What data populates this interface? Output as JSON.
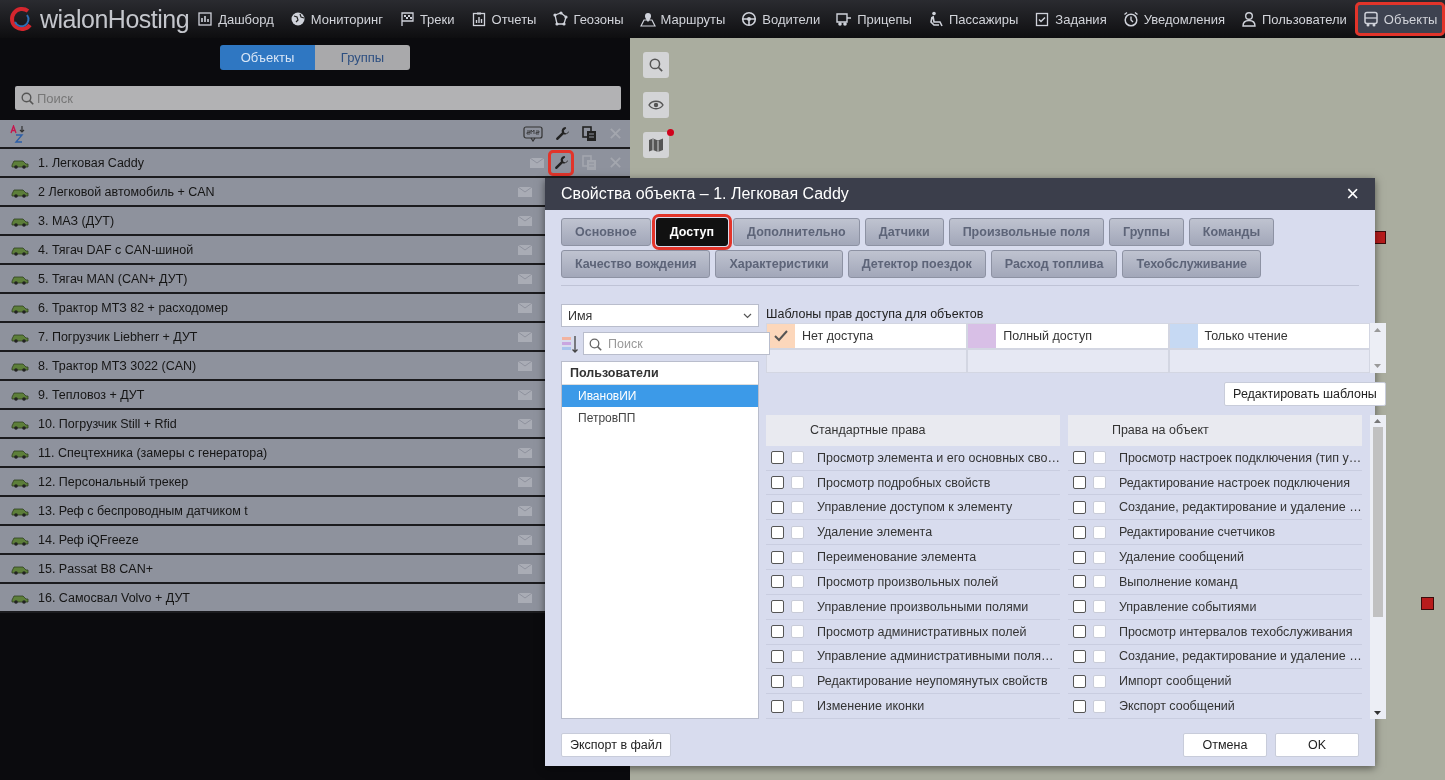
{
  "top_bar": {
    "logo": "wialonHosting",
    "nav": [
      {
        "label": "Дашборд",
        "selected": false,
        "highlighted": false
      },
      {
        "label": "Мониторинг",
        "selected": false,
        "highlighted": false
      },
      {
        "label": "Треки",
        "selected": false,
        "highlighted": false
      },
      {
        "label": "Отчеты",
        "selected": false,
        "highlighted": false
      },
      {
        "label": "Геозоны",
        "selected": false,
        "highlighted": false
      },
      {
        "label": "Маршруты",
        "selected": false,
        "highlighted": false
      },
      {
        "label": "Водители",
        "selected": false,
        "highlighted": false
      },
      {
        "label": "Прицепы",
        "selected": false,
        "highlighted": false
      },
      {
        "label": "Пассажиры",
        "selected": false,
        "highlighted": false
      },
      {
        "label": "Задания",
        "selected": false,
        "highlighted": false
      },
      {
        "label": "Уведомления",
        "selected": false,
        "highlighted": false
      },
      {
        "label": "Пользователи",
        "selected": false,
        "highlighted": false
      },
      {
        "label": "Объекты",
        "selected": true,
        "highlighted": true
      }
    ]
  },
  "left_panel": {
    "tabs": [
      {
        "label": "Объекты",
        "selected": true
      },
      {
        "label": "Группы",
        "selected": false
      }
    ],
    "search": {
      "placeholder": "Поиск"
    },
    "units": [
      {
        "name": "1. Легковая Caddy",
        "tools": {
          "highlighted": true
        }
      },
      {
        "name": "2 Легковой автомобиль + CAN"
      },
      {
        "name": "3. МАЗ (ДУТ)"
      },
      {
        "name": "4. Тягач DAF с CAN-шиной"
      },
      {
        "name": "5. Тягач MAN (CAN+ ДУТ)"
      },
      {
        "name": "6. Трактор МТЗ 82 + расходомер"
      },
      {
        "name": "7. Погрузчик Liebherr + ДУТ"
      },
      {
        "name": "8. Трактор МТЗ 3022 (CAN)"
      },
      {
        "name": "9. Тепловоз + ДУТ"
      },
      {
        "name": "10. Погрузчик Still + Rfid"
      },
      {
        "name": "11. Спецтехника (замеры с генератора)"
      },
      {
        "name": "12. Персональный трекер"
      },
      {
        "name": "13. Реф с беспроводным датчиком t"
      },
      {
        "name": "14. Реф iQFreeze"
      },
      {
        "name": "15. Passat B8 CAN+"
      },
      {
        "name": "16. Самосвал Volvo + ДУТ"
      }
    ]
  },
  "dialog": {
    "title": "Свойства объекта – 1. Легковая Caddy",
    "close": "×",
    "tab_rows": [
      [
        {
          "label": "Основное",
          "selected": false,
          "highlighted": false
        },
        {
          "label": "Доступ",
          "selected": true,
          "highlighted": true
        },
        {
          "label": "Дополнительно",
          "selected": false,
          "highlighted": false
        },
        {
          "label": "Датчики",
          "selected": false,
          "highlighted": false
        },
        {
          "label": "Произвольные поля",
          "selected": false,
          "highlighted": false
        },
        {
          "label": "Группы",
          "selected": false,
          "highlighted": false
        },
        {
          "label": "Команды",
          "selected": false,
          "highlighted": false
        }
      ],
      [
        {
          "label": "Качество вождения",
          "selected": false,
          "highlighted": false
        },
        {
          "label": "Характеристики",
          "selected": false,
          "highlighted": false
        },
        {
          "label": "Детектор поездок",
          "selected": false,
          "highlighted": false
        },
        {
          "label": "Расход топлива",
          "selected": false,
          "highlighted": false
        },
        {
          "label": "Техобслуживание",
          "selected": false,
          "highlighted": false
        }
      ]
    ],
    "filter_select": "Имя",
    "user_search": {
      "placeholder": "Поиск"
    },
    "users": {
      "header": "Пользователи",
      "items": [
        {
          "name": "ИвановИИ",
          "selected": true
        },
        {
          "name": "ПетровПП",
          "selected": false
        }
      ]
    },
    "templates": {
      "title": "Шаблоны прав доступа для объектов",
      "items": [
        {
          "label": "Нет доступа",
          "color": "#fcd7bb",
          "selected": true
        },
        {
          "label": "Полный доступ",
          "color": "#d8bfe6",
          "selected": false
        },
        {
          "label": "Только чтение",
          "color": "#c6d9f3",
          "selected": false
        }
      ]
    },
    "edit_templates": "Редактировать шаблоны",
    "rights_columns": [
      {
        "header": "Стандартные права",
        "rights": [
          {
            "label": "Просмотр элемента и его основных сво…",
            "checked": false,
            "grant_checked": false,
            "grant_disabled": true
          },
          {
            "label": "Просмотр подробных свойств",
            "checked": false,
            "grant_checked": false,
            "grant_disabled": true
          },
          {
            "label": "Управление доступом к элементу",
            "checked": false,
            "grant_checked": false,
            "grant_disabled": true
          },
          {
            "label": "Удаление элемента",
            "checked": false,
            "grant_checked": false,
            "grant_disabled": true
          },
          {
            "label": "Переименование элемента",
            "checked": false,
            "grant_checked": false,
            "grant_disabled": true
          },
          {
            "label": "Просмотр произвольных полей",
            "checked": false,
            "grant_checked": false,
            "grant_disabled": true
          },
          {
            "label": "Управление произвольными полями",
            "checked": false,
            "grant_checked": false,
            "grant_disabled": true
          },
          {
            "label": "Просмотр административных полей",
            "checked": false,
            "grant_checked": false,
            "grant_disabled": true
          },
          {
            "label": "Управление административными поля…",
            "checked": false,
            "grant_checked": false,
            "grant_disabled": true
          },
          {
            "label": "Редактирование неупомянутых свойств",
            "checked": false,
            "grant_checked": false,
            "grant_disabled": true
          },
          {
            "label": "Изменение иконки",
            "checked": false,
            "grant_checked": false,
            "grant_disabled": true
          }
        ]
      },
      {
        "header": "Права на объект",
        "rights": [
          {
            "label": "Просмотр настроек подключения (тип у…",
            "checked": false,
            "grant_checked": false,
            "grant_disabled": true
          },
          {
            "label": "Редактирование настроек подключения",
            "checked": false,
            "grant_checked": false,
            "grant_disabled": true
          },
          {
            "label": "Создание, редактирование и удаление …",
            "checked": false,
            "grant_checked": false,
            "grant_disabled": true
          },
          {
            "label": "Редактирование счетчиков",
            "checked": false,
            "grant_checked": false,
            "grant_disabled": true
          },
          {
            "label": "Удаление сообщений",
            "checked": false,
            "grant_checked": false,
            "grant_disabled": true
          },
          {
            "label": "Выполнение команд",
            "checked": false,
            "grant_checked": false,
            "grant_disabled": true
          },
          {
            "label": "Управление событиями",
            "checked": false,
            "grant_checked": false,
            "grant_disabled": true
          },
          {
            "label": "Просмотр интервалов техобслуживания",
            "checked": false,
            "grant_checked": false,
            "grant_disabled": true
          },
          {
            "label": "Создание, редактирование и удаление …",
            "checked": false,
            "grant_checked": false,
            "grant_disabled": true
          },
          {
            "label": "Импорт сообщений",
            "checked": false,
            "grant_checked": false,
            "grant_disabled": true
          },
          {
            "label": "Экспорт сообщений",
            "checked": false,
            "grant_checked": false,
            "grant_disabled": true
          }
        ]
      }
    ],
    "buttons": {
      "export": "Экспорт в файл",
      "cancel": "Отмена",
      "ok": "OK"
    }
  }
}
